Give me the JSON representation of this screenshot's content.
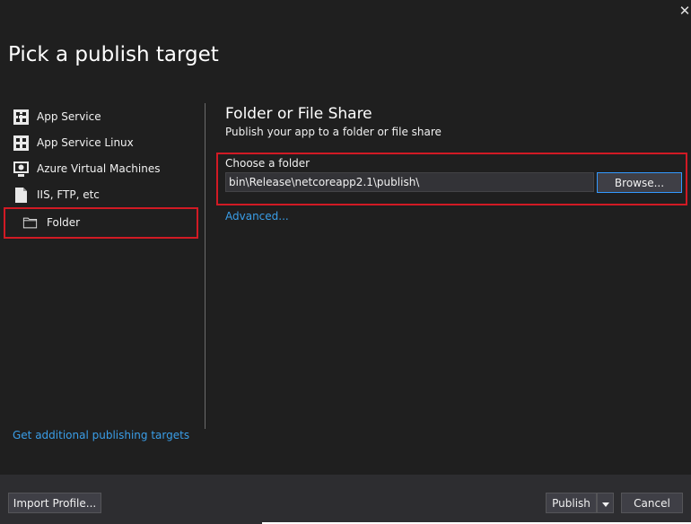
{
  "dialog": {
    "title": "Pick a publish target",
    "close_glyph": "✕"
  },
  "sidebar": {
    "items": [
      {
        "label": "App Service",
        "icon": "app-service-icon"
      },
      {
        "label": "App Service Linux",
        "icon": "app-service-linux-icon"
      },
      {
        "label": "Azure Virtual Machines",
        "icon": "virtual-machine-icon"
      },
      {
        "label": "IIS, FTP, etc",
        "icon": "document-icon"
      },
      {
        "label": "Folder",
        "icon": "folder-icon",
        "selected": true
      }
    ],
    "more_link": "Get additional publishing targets"
  },
  "panel": {
    "title": "Folder or File Share",
    "subtitle": "Publish your app to a folder or file share",
    "folder_label": "Choose a folder",
    "folder_value": "bin\\Release\\netcoreapp2.1\\publish\\",
    "browse_label": "Browse...",
    "advanced_link": "Advanced..."
  },
  "footer": {
    "import_label": "Import Profile...",
    "publish_label": "Publish",
    "cancel_label": "Cancel"
  },
  "colors": {
    "background": "#1f1f1f",
    "footer": "#2d2d30",
    "highlight_border": "#d11a24",
    "link": "#3a9ee8",
    "focus_border": "#3399ff"
  }
}
